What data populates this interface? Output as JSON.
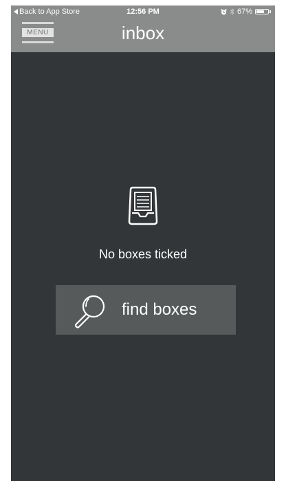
{
  "status_bar": {
    "back_label": "Back to App Store",
    "time": "12:56 PM",
    "battery_percent": "67%",
    "battery_level": 0.67,
    "icons": [
      "back-arrow-icon",
      "alarm-icon",
      "bluetooth-icon",
      "battery-icon"
    ]
  },
  "header": {
    "menu_label": "MENU",
    "title": "inbox"
  },
  "empty_state": {
    "icon": "inbox-tray-icon",
    "message": "No boxes ticked"
  },
  "find_button": {
    "icon": "magnifier-icon",
    "label": "find boxes"
  },
  "colors": {
    "background": "#333638",
    "header": "#8a8b8b",
    "button": "#575a5b",
    "text": "#ffffff"
  }
}
